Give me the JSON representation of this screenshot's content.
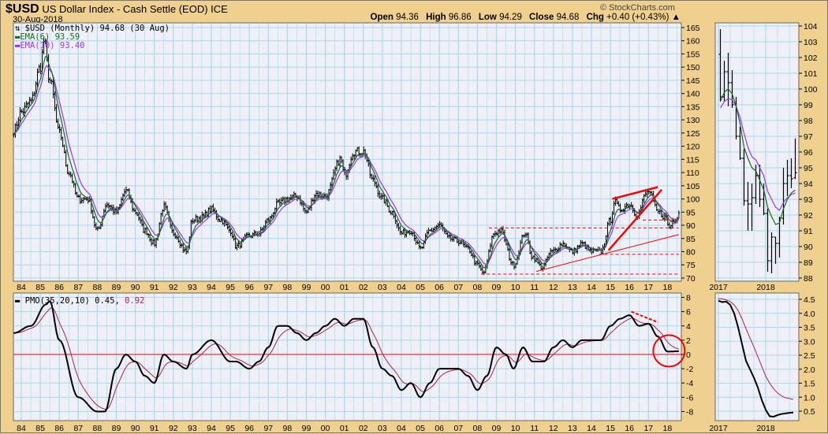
{
  "header": {
    "symbol": "$USD",
    "name": "US Dollar Index - Cash Settle (EOD)",
    "exchange": "ICE",
    "date": "30-Aug-2018",
    "copyright": "© StockCharts.com",
    "open_label": "Open",
    "open": "94.36",
    "high_label": "High",
    "high": "96.86",
    "low_label": "Low",
    "low": "94.29",
    "close_label": "Close",
    "close": "94.68",
    "chg_label": "Chg",
    "chg": "+0.40 (+0.43%)"
  },
  "legend": {
    "price": "$USD (Monthly) 94.68 (30 Aug)",
    "ema6": "EMA(6) 93.59",
    "ema10": "EMA(10) 93.40",
    "pmo": "PMO(35,20,10) 0.45,",
    "pmo_signal": "0.92"
  },
  "colors": {
    "price": "#000000",
    "ema6": "#1a6b1a",
    "ema10": "#9933ff",
    "pmo": "#000000",
    "pmo_signal": "#b0204a",
    "annotation": "#ff0000",
    "grid": "#a9d9ea",
    "panel": "#eeeff7"
  },
  "chart_data": [
    {
      "type": "line",
      "title": "$USD Monthly price (OHLC bars) with EMA(6), EMA(10)",
      "x_tick_labels": [
        "84",
        "85",
        "86",
        "87",
        "88",
        "89",
        "90",
        "91",
        "92",
        "93",
        "94",
        "95",
        "96",
        "97",
        "98",
        "99",
        "00",
        "01",
        "02",
        "03",
        "04",
        "05",
        "06",
        "07",
        "08",
        "09",
        "10",
        "11",
        "12",
        "13",
        "14",
        "15",
        "16",
        "17",
        "18"
      ],
      "y_ticks": [
        70,
        75,
        80,
        85,
        90,
        95,
        100,
        105,
        110,
        115,
        120,
        125,
        130,
        135,
        140,
        145,
        150,
        155,
        160,
        165
      ],
      "ylim": [
        70,
        165
      ],
      "xlim": [
        1983.6,
        2018.8
      ],
      "close_anchors": [
        [
          1983.6,
          126
        ],
        [
          1984.0,
          133
        ],
        [
          1984.5,
          137
        ],
        [
          1985.0,
          150
        ],
        [
          1985.2,
          160
        ],
        [
          1985.5,
          145
        ],
        [
          1986.0,
          125
        ],
        [
          1986.5,
          110
        ],
        [
          1987.0,
          100
        ],
        [
          1987.5,
          100
        ],
        [
          1988.0,
          88
        ],
        [
          1988.5,
          98
        ],
        [
          1989.0,
          95
        ],
        [
          1989.5,
          103
        ],
        [
          1990.0,
          95
        ],
        [
          1990.5,
          88
        ],
        [
          1991.0,
          83
        ],
        [
          1991.5,
          97
        ],
        [
          1992.0,
          87
        ],
        [
          1992.7,
          80
        ],
        [
          1993.0,
          92
        ],
        [
          1993.5,
          93
        ],
        [
          1994.0,
          96
        ],
        [
          1994.5,
          92
        ],
        [
          1995.0,
          88
        ],
        [
          1995.3,
          82
        ],
        [
          1996.0,
          86
        ],
        [
          1996.5,
          87
        ],
        [
          1997.0,
          92
        ],
        [
          1997.5,
          98
        ],
        [
          1998.0,
          100
        ],
        [
          1998.5,
          101
        ],
        [
          1999.0,
          95
        ],
        [
          1999.5,
          102
        ],
        [
          2000.0,
          101
        ],
        [
          2000.8,
          115
        ],
        [
          2001.0,
          109
        ],
        [
          2001.5,
          118
        ],
        [
          2002.0,
          118
        ],
        [
          2002.5,
          107
        ],
        [
          2003.0,
          100
        ],
        [
          2003.5,
          95
        ],
        [
          2004.0,
          87
        ],
        [
          2004.5,
          88
        ],
        [
          2005.0,
          81
        ],
        [
          2005.5,
          88
        ],
        [
          2006.0,
          90
        ],
        [
          2006.5,
          85
        ],
        [
          2007.0,
          84
        ],
        [
          2007.5,
          81
        ],
        [
          2008.0,
          75
        ],
        [
          2008.3,
          72
        ],
        [
          2008.9,
          87
        ],
        [
          2009.2,
          88
        ],
        [
          2009.9,
          75
        ],
        [
          2010.5,
          87
        ],
        [
          2010.9,
          78
        ],
        [
          2011.4,
          74
        ],
        [
          2011.9,
          80
        ],
        [
          2012.5,
          83
        ],
        [
          2013.0,
          80
        ],
        [
          2013.5,
          83
        ],
        [
          2014.0,
          80
        ],
        [
          2014.5,
          80
        ],
        [
          2015.0,
          92
        ],
        [
          2015.2,
          99
        ],
        [
          2015.5,
          96
        ],
        [
          2016.0,
          98
        ],
        [
          2016.4,
          94
        ],
        [
          2016.9,
          102
        ],
        [
          2017.0,
          103
        ],
        [
          2017.5,
          95
        ],
        [
          2017.9,
          93
        ],
        [
          2018.1,
          89
        ],
        [
          2018.3,
          92
        ],
        [
          2018.67,
          94.68
        ]
      ],
      "annotations": {
        "trend_lines": [
          {
            "from": [
              2015.1,
              100
            ],
            "to": [
              2017.5,
              104.5
            ],
            "style": "thick"
          },
          {
            "from": [
              2014.9,
              80.5
            ],
            "to": [
              2017.7,
              103.5
            ],
            "style": "thick"
          },
          {
            "from": [
              2011.1,
              72.5
            ],
            "to": [
              2018.6,
              86.5
            ],
            "style": "thin"
          }
        ],
        "dashed_levels": [
          {
            "value": 89,
            "from": 2008.6,
            "to": 2018.6
          },
          {
            "value": 92,
            "from": 2016.7,
            "to": 2018.6
          },
          {
            "value": 79,
            "from": 2014.4,
            "to": 2018.6
          },
          {
            "value": 71.5,
            "from": 2008.2,
            "to": 2018.6
          }
        ]
      }
    },
    {
      "type": "line",
      "title": "PMO(35,20,10)",
      "y_ticks": [
        8,
        6,
        4,
        2,
        0,
        -2,
        -4,
        -6,
        -8
      ],
      "y_tick_labels": [
        "8",
        "6",
        "4",
        "2",
        "0",
        "-2",
        "-4",
        "-6",
        "-8"
      ],
      "ylim": [
        -9,
        8.5
      ],
      "pmo_anchors": [
        [
          1983.6,
          3
        ],
        [
          1984.5,
          4
        ],
        [
          1985.3,
          7
        ],
        [
          1985.5,
          7.5
        ],
        [
          1986.0,
          2
        ],
        [
          1987.0,
          -6
        ],
        [
          1988.0,
          -8
        ],
        [
          1988.4,
          -8
        ],
        [
          1989.0,
          -2
        ],
        [
          1989.5,
          0
        ],
        [
          1990.0,
          -1
        ],
        [
          1990.5,
          -3
        ],
        [
          1991.0,
          -4
        ],
        [
          1991.5,
          0
        ],
        [
          1992.0,
          -1
        ],
        [
          1992.7,
          -2
        ],
        [
          1993.0,
          0
        ],
        [
          1994.0,
          2
        ],
        [
          1995.0,
          -1
        ],
        [
          1995.3,
          -1
        ],
        [
          1996.0,
          -2
        ],
        [
          1996.5,
          -1
        ],
        [
          1997.0,
          1
        ],
        [
          1997.5,
          4
        ],
        [
          1998.0,
          4
        ],
        [
          1998.5,
          3
        ],
        [
          1999.0,
          2
        ],
        [
          1999.5,
          3
        ],
        [
          2000.0,
          4
        ],
        [
          2000.5,
          5
        ],
        [
          2001.0,
          4
        ],
        [
          2001.5,
          5
        ],
        [
          2002.0,
          5
        ],
        [
          2002.5,
          1
        ],
        [
          2003.0,
          -2
        ],
        [
          2003.5,
          -3
        ],
        [
          2004.0,
          -5
        ],
        [
          2004.5,
          -4
        ],
        [
          2005.0,
          -6
        ],
        [
          2005.5,
          -4
        ],
        [
          2006.0,
          -2
        ],
        [
          2006.5,
          -2
        ],
        [
          2007.0,
          -2
        ],
        [
          2007.5,
          -3
        ],
        [
          2008.0,
          -5
        ],
        [
          2008.5,
          -3
        ],
        [
          2009.0,
          1
        ],
        [
          2009.5,
          0
        ],
        [
          2009.9,
          -2
        ],
        [
          2010.4,
          1
        ],
        [
          2010.9,
          -1
        ],
        [
          2011.5,
          -1
        ],
        [
          2012.0,
          1
        ],
        [
          2012.5,
          2
        ],
        [
          2013.0,
          1
        ],
        [
          2013.5,
          2
        ],
        [
          2014.0,
          2
        ],
        [
          2014.5,
          2
        ],
        [
          2015.0,
          4
        ],
        [
          2015.5,
          5
        ],
        [
          2016.0,
          5.5
        ],
        [
          2016.5,
          4
        ],
        [
          2017.0,
          4.3
        ],
        [
          2017.5,
          2.5
        ],
        [
          2018.0,
          0.4
        ],
        [
          2018.67,
          0.45
        ]
      ],
      "annotations": {
        "zero_line": 0,
        "dashed_lines": [
          {
            "from": [
              2016.1,
              6
            ],
            "to": [
              2017.5,
              4.5
            ]
          }
        ],
        "circle": {
          "center": [
            2018.0,
            0.5
          ]
        }
      }
    },
    {
      "type": "line",
      "title": "$USD monthly 2017-2018 (zoom)",
      "x_tick_labels": [
        "2017",
        "2018"
      ],
      "y_ticks": [
        88,
        89,
        90,
        91,
        92,
        93,
        94,
        95,
        96,
        97,
        98,
        99,
        100,
        101,
        102,
        103,
        104
      ],
      "ylim": [
        88,
        104
      ],
      "ohlc": [
        [
          102.2,
          103.8,
          99.2,
          99.5
        ],
        [
          99.5,
          101.8,
          99.2,
          101.1
        ],
        [
          101.1,
          102.3,
          98.9,
          100.4
        ],
        [
          100.4,
          101.2,
          98.8,
          99.0
        ],
        [
          99.0,
          99.5,
          96.8,
          97.0
        ],
        [
          97.0,
          97.6,
          95.5,
          95.6
        ],
        [
          95.6,
          96.2,
          92.6,
          92.9
        ],
        [
          92.9,
          94.1,
          91.0,
          92.7
        ],
        [
          92.7,
          94.0,
          91.0,
          93.1
        ],
        [
          93.1,
          95.2,
          92.7,
          94.5
        ],
        [
          94.5,
          95.2,
          92.5,
          93.0
        ],
        [
          93.0,
          94.0,
          92.0,
          92.1
        ],
        [
          92.1,
          92.4,
          88.4,
          89.1
        ],
        [
          89.1,
          90.9,
          88.3,
          90.6
        ],
        [
          90.6,
          90.6,
          88.9,
          90.2
        ],
        [
          90.2,
          91.9,
          89.3,
          91.8
        ],
        [
          91.8,
          95.0,
          91.4,
          94.0
        ],
        [
          94.0,
          95.5,
          93.2,
          94.5
        ],
        [
          94.5,
          95.6,
          93.7,
          94.3
        ],
        [
          94.36,
          96.86,
          94.29,
          94.68
        ]
      ],
      "ema6": [
        99.2,
        99.8,
        100.0,
        99.7,
        98.9,
        97.8,
        96.3,
        95.6,
        95.0,
        94.8,
        94.2,
        93.6,
        92.5,
        91.9,
        91.4,
        91.5,
        92.4,
        93.0,
        93.4,
        93.59
      ],
      "ema10": [
        98.8,
        99.2,
        99.4,
        99.3,
        98.9,
        98.2,
        97.2,
        96.3,
        95.7,
        95.5,
        95.0,
        94.5,
        93.5,
        93.0,
        92.5,
        92.3,
        92.8,
        93.1,
        93.3,
        93.4
      ]
    },
    {
      "type": "line",
      "title": "PMO 2017-2018 (zoom)",
      "y_ticks": [
        0.5,
        1.0,
        1.5,
        2.0,
        2.5,
        3.0,
        3.5,
        4.0,
        4.5
      ],
      "y_tick_labels": [
        "0.5",
        "1.0",
        "1.5",
        "2.0",
        "2.5",
        "3.0",
        "3.5",
        "4.0",
        "4.5"
      ],
      "ylim": [
        0.1,
        4.6
      ],
      "pmo": [
        4.45,
        4.4,
        4.42,
        4.3,
        4.0,
        3.5,
        2.9,
        2.3,
        2.0,
        1.7,
        1.35,
        0.9,
        0.55,
        0.32,
        0.3,
        0.36,
        0.4,
        0.42,
        0.44,
        0.45
      ],
      "signal": [
        4.52,
        4.52,
        4.48,
        4.42,
        4.3,
        4.1,
        3.8,
        3.45,
        3.12,
        2.8,
        2.45,
        2.1,
        1.75,
        1.5,
        1.3,
        1.15,
        1.05,
        0.98,
        0.95,
        0.92
      ]
    }
  ]
}
